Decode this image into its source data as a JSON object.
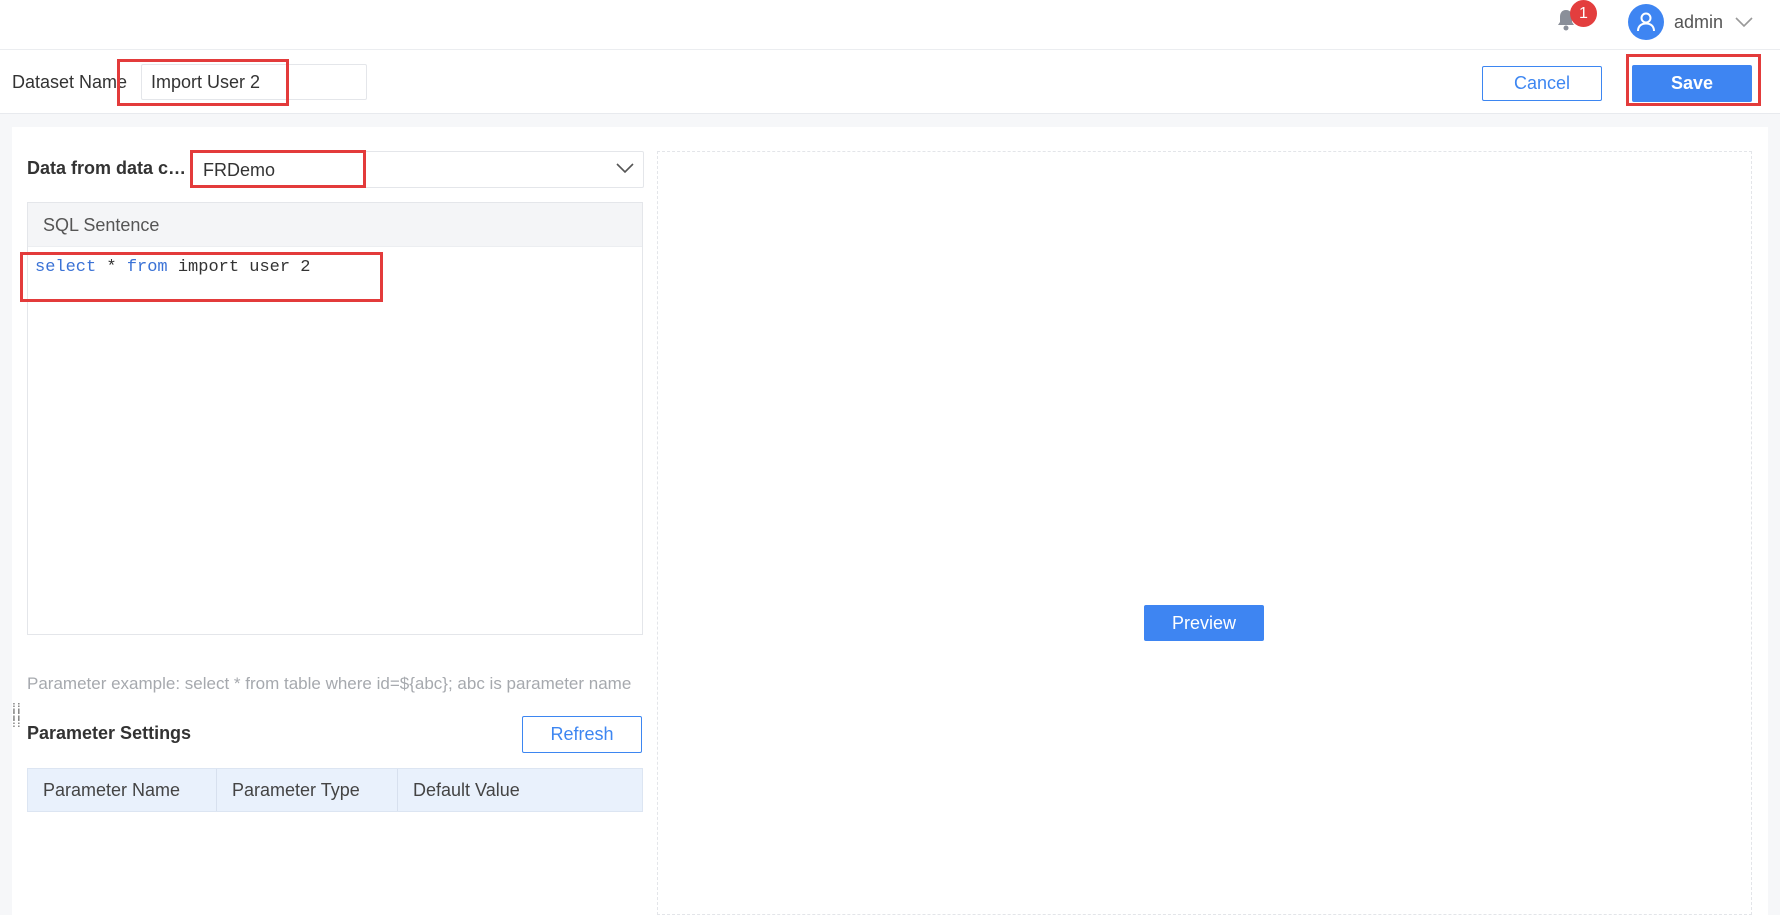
{
  "topbar": {
    "notification_count": "1",
    "user_name": "admin"
  },
  "dataset": {
    "name_label": "Dataset Name",
    "name_value": "Import User 2",
    "cancel_label": "Cancel",
    "save_label": "Save"
  },
  "connection": {
    "label": "Data from data connection",
    "selected": "FRDemo"
  },
  "sql": {
    "header": "SQL Sentence",
    "keyword_select": "select",
    "star": " * ",
    "keyword_from": "from",
    "table": " import user 2"
  },
  "parameters": {
    "hint": "Parameter example: select * from table where id=${abc}; abc is parameter name",
    "title": "Parameter Settings",
    "refresh_label": "Refresh",
    "columns": [
      "Parameter Name",
      "Parameter Type",
      "Default Value"
    ]
  },
  "preview": {
    "button_label": "Preview"
  },
  "colors": {
    "accent": "#3e85f2",
    "highlight": "#e33b3b",
    "badge": "#e33e3e"
  },
  "icons": [
    "bell-icon",
    "user-avatar-icon",
    "chevron-down-icon",
    "drag-handle-icon"
  ]
}
